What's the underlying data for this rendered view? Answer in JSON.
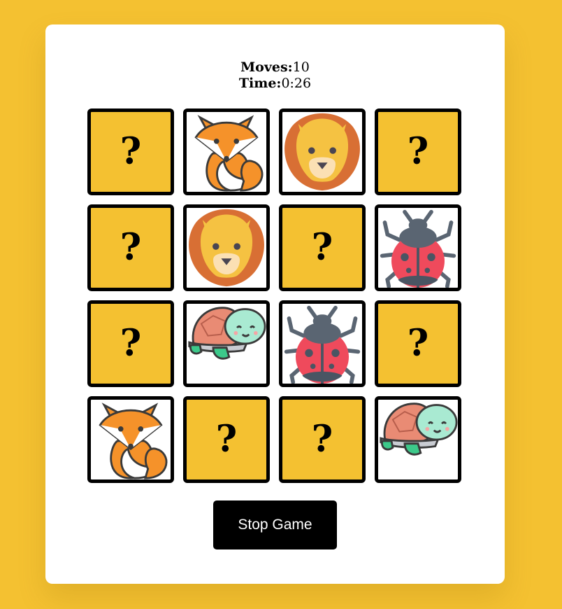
{
  "stats": {
    "moves_label": "Moves:",
    "moves_value": "10",
    "time_label": "Time:",
    "time_value": "0:26"
  },
  "hidden_symbol": "?",
  "cards": [
    {
      "state": "hidden"
    },
    {
      "state": "shown",
      "animal": "fox"
    },
    {
      "state": "shown",
      "animal": "lion"
    },
    {
      "state": "hidden"
    },
    {
      "state": "hidden"
    },
    {
      "state": "shown",
      "animal": "lion"
    },
    {
      "state": "hidden"
    },
    {
      "state": "shown",
      "animal": "ladybug"
    },
    {
      "state": "hidden"
    },
    {
      "state": "shown",
      "animal": "turtle"
    },
    {
      "state": "shown",
      "animal": "ladybug"
    },
    {
      "state": "hidden"
    },
    {
      "state": "shown",
      "animal": "fox"
    },
    {
      "state": "hidden"
    },
    {
      "state": "hidden"
    },
    {
      "state": "shown",
      "animal": "turtle"
    }
  ],
  "stop_button": "Stop Game",
  "colors": {
    "background": "#f4c131",
    "card_back": "#f4c131",
    "button": "#000000"
  }
}
